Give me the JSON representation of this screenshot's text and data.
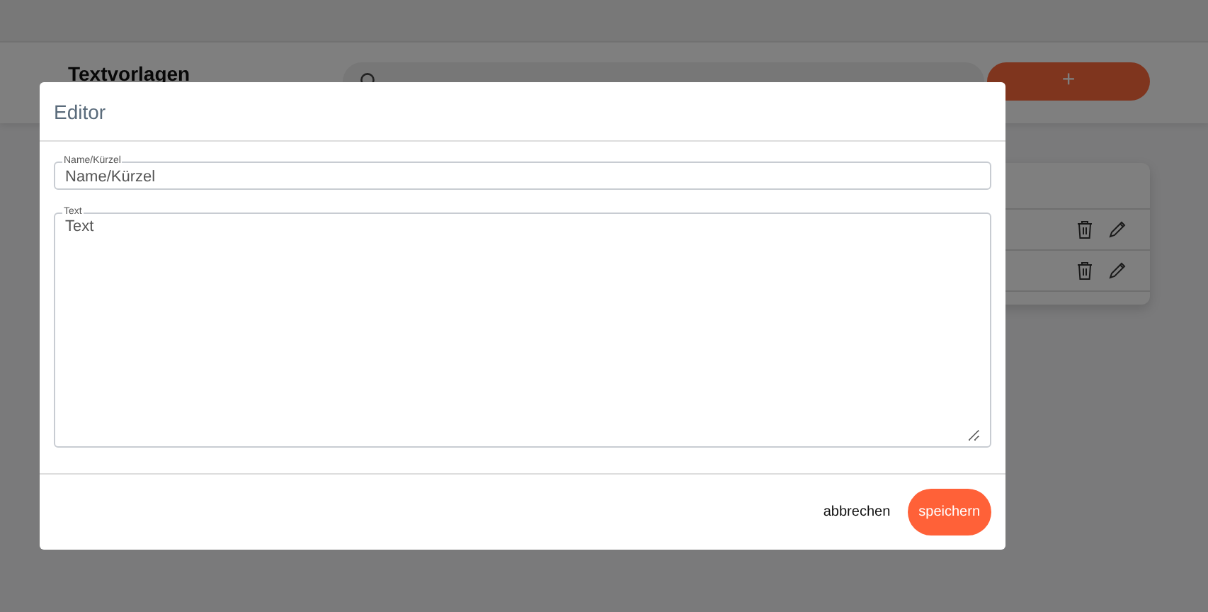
{
  "page": {
    "title": "Textvorlagen",
    "add_button": "+",
    "rows": [
      {
        "kind": "template"
      },
      {
        "kind": "template"
      }
    ]
  },
  "dialog": {
    "title": "Editor",
    "fields": [
      {
        "kind": "input",
        "label": "Name/Kürzel",
        "placeholder": "Name/Kürzel"
      },
      {
        "kind": "textarea",
        "label": "Text",
        "placeholder": "Text"
      }
    ],
    "buttons": [
      {
        "kind": "plain",
        "label": "abbrechen"
      },
      {
        "kind": "primary",
        "label": "speichern"
      }
    ]
  }
}
